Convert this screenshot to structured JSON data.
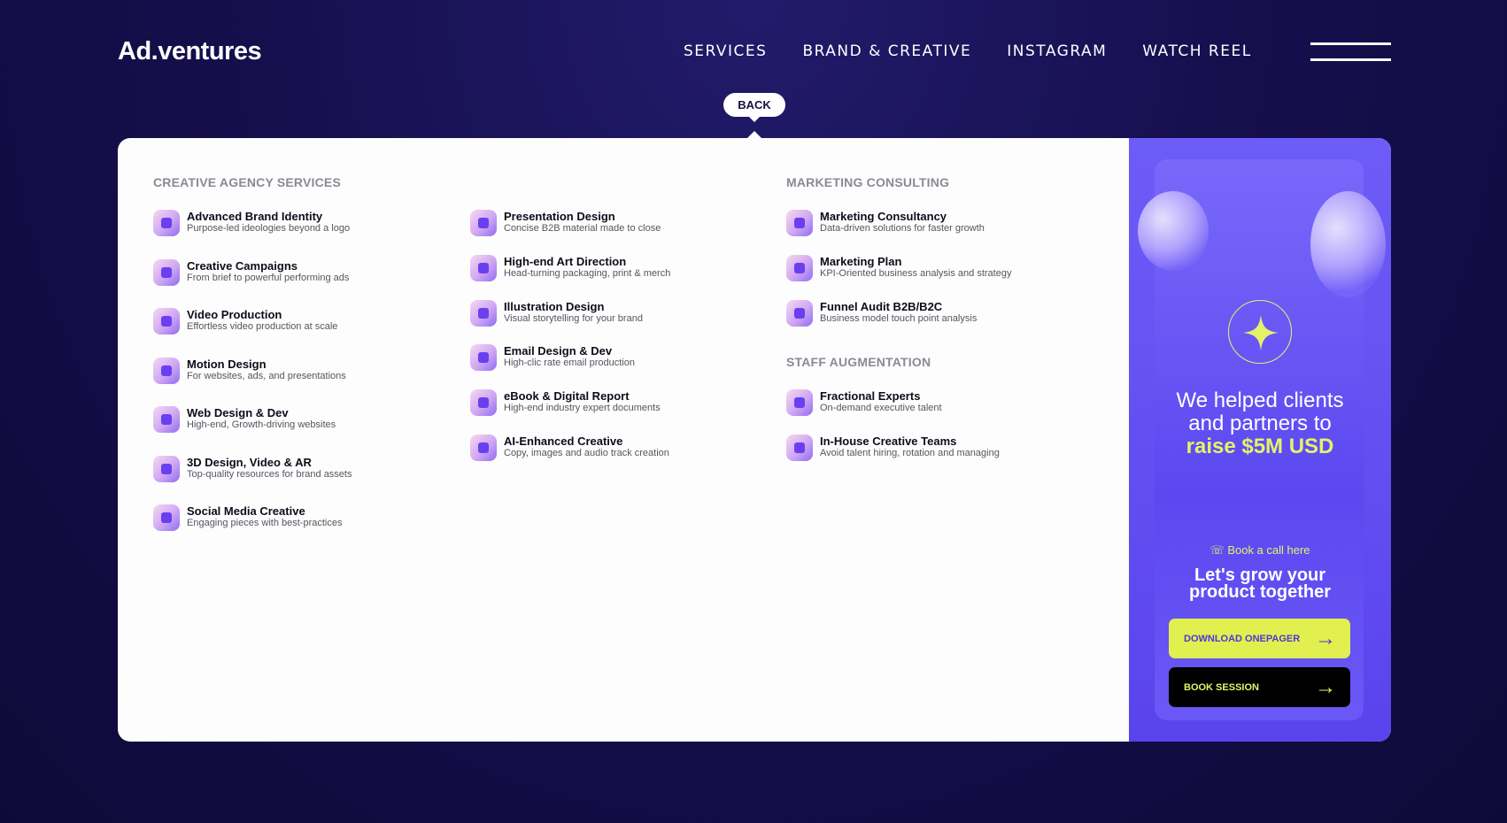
{
  "header": {
    "logo": "Ad.ventures",
    "nav": [
      "SERVICES",
      "BRAND & CREATIVE",
      "INSTAGRAM",
      "WATCH REEL"
    ],
    "back_label": "BACK"
  },
  "creative": {
    "title": "CREATIVE AGENCY SERVICES",
    "col1": [
      {
        "name": "Advanced Brand Identity",
        "desc": "Purpose-led ideologies beyond a logo"
      },
      {
        "name": "Creative  Campaigns",
        "desc": "From brief to powerful performing ads"
      },
      {
        "name": "Video Production",
        "desc": "Effortless video production at scale"
      },
      {
        "name": "Motion Design",
        "desc": "For websites, ads, and presentations"
      },
      {
        "name": "Web Design & Dev",
        "desc": "High-end, Growth-driving websites"
      },
      {
        "name": "3D Design, Video & AR",
        "desc": "Top-quality resources for brand assets"
      },
      {
        "name": "Social Media Creative",
        "desc": "Engaging pieces with best-practices"
      }
    ],
    "col2": [
      {
        "name": "Presentation Design",
        "desc": "Concise B2B material made to close"
      },
      {
        "name": "High-end Art Direction",
        "desc": "Head-turning packaging, print & merch"
      },
      {
        "name": "Illustration Design",
        "desc": "Visual storytelling for your brand"
      },
      {
        "name": "Email Design & Dev",
        "desc": "High-clic rate email production"
      },
      {
        "name": "eBook & Digital Report",
        "desc": "High-end industry expert documents"
      },
      {
        "name": "AI-Enhanced Creative",
        "desc": "Copy, images and audio track creation"
      }
    ]
  },
  "marketing": {
    "title": "MARKETING CONSULTING",
    "items": [
      {
        "name": "Marketing Consultancy",
        "desc": "Data-driven solutions for faster growth"
      },
      {
        "name": "Marketing Plan",
        "desc": "KPI-Oriented business analysis and strategy"
      },
      {
        "name": "Funnel Audit B2B/B2C",
        "desc": "Business model touch point analysis"
      }
    ]
  },
  "staff": {
    "title": "STAFF AUGMENTATION",
    "items": [
      {
        "name": "Fractional Experts",
        "desc": "On-demand executive talent"
      },
      {
        "name": "In-House Creative Teams",
        "desc": "Avoid talent hiring, rotation and managing"
      }
    ]
  },
  "promo": {
    "line1": "We helped clients",
    "line2": "and partners to",
    "highlight": "raise $5M USD",
    "call_link": "Book a call here",
    "grow1": "Let's grow your",
    "grow2": "product together",
    "download_label": "DOWNLOAD ONEPAGER",
    "book_label": "BOOK SESSION",
    "accent": "#e4f26a",
    "purple": "#5b48f0"
  }
}
